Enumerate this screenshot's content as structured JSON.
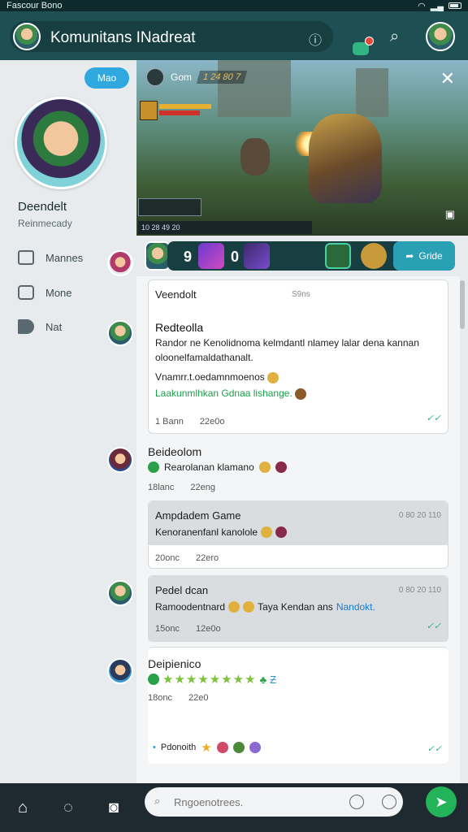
{
  "status": {
    "time": "Fascour Bono"
  },
  "header": {
    "title": "Komunitans INadreat"
  },
  "sidebar": {
    "button_label": "Mao",
    "profile_name": "Deendelt",
    "profile_sub": "Reinmecady",
    "items": [
      {
        "label": "Mannes",
        "icon": "house-icon"
      },
      {
        "label": "Mone",
        "icon": "chat-icon"
      },
      {
        "label": "Nat",
        "icon": "megaphone-icon"
      }
    ]
  },
  "video": {
    "title": "Gom",
    "score": "1 24 80 7",
    "hud_text": "10 28 49 20"
  },
  "gamebar": {
    "num1": "9",
    "num2": "0",
    "button_label": "Gride"
  },
  "feed": {
    "card1": {
      "author": "Veendolt",
      "time": "S9ns",
      "title": "Redteolla",
      "text": "Randor ne Kenolidnoma kelmdantl nlamey lalar dena kannan oloonelfamaldathanalt.",
      "line2": "Vnamrr.t.oedamnmoenos",
      "green_line": "Laakunmlhkan Gdnaa lishange.",
      "meta_a": "1 Bann",
      "meta_b": "22e0o"
    },
    "post2": {
      "author": "Beideolom",
      "text": "Rearolanan klamano",
      "meta_a": "18lanc",
      "meta_b": "22eng"
    },
    "card3": {
      "title": "Ampdadem Game",
      "time": "0 80 20 110",
      "text": "Kenoranenfanl kanolole",
      "meta_a": "20onc",
      "meta_b": "22ero"
    },
    "card4": {
      "title": "Pedel dcan",
      "time": "0 80 20 110",
      "text": "Ramoodentnard",
      "text_b": "Taya Kendan ans",
      "link": "Nandokt.",
      "meta_a": "15onc",
      "meta_b": "12e0o"
    },
    "post5": {
      "author": "Deipienico",
      "stars": "★★★★★★★★",
      "meta_a": "18onc",
      "meta_b": "22e0"
    },
    "post5_footer": "Pdonoith"
  },
  "composer": {
    "placeholder": "Rngoenotrees."
  },
  "colors": {
    "header": "#1e4f52",
    "accent": "#2fa8e0",
    "send": "#23b45a"
  }
}
